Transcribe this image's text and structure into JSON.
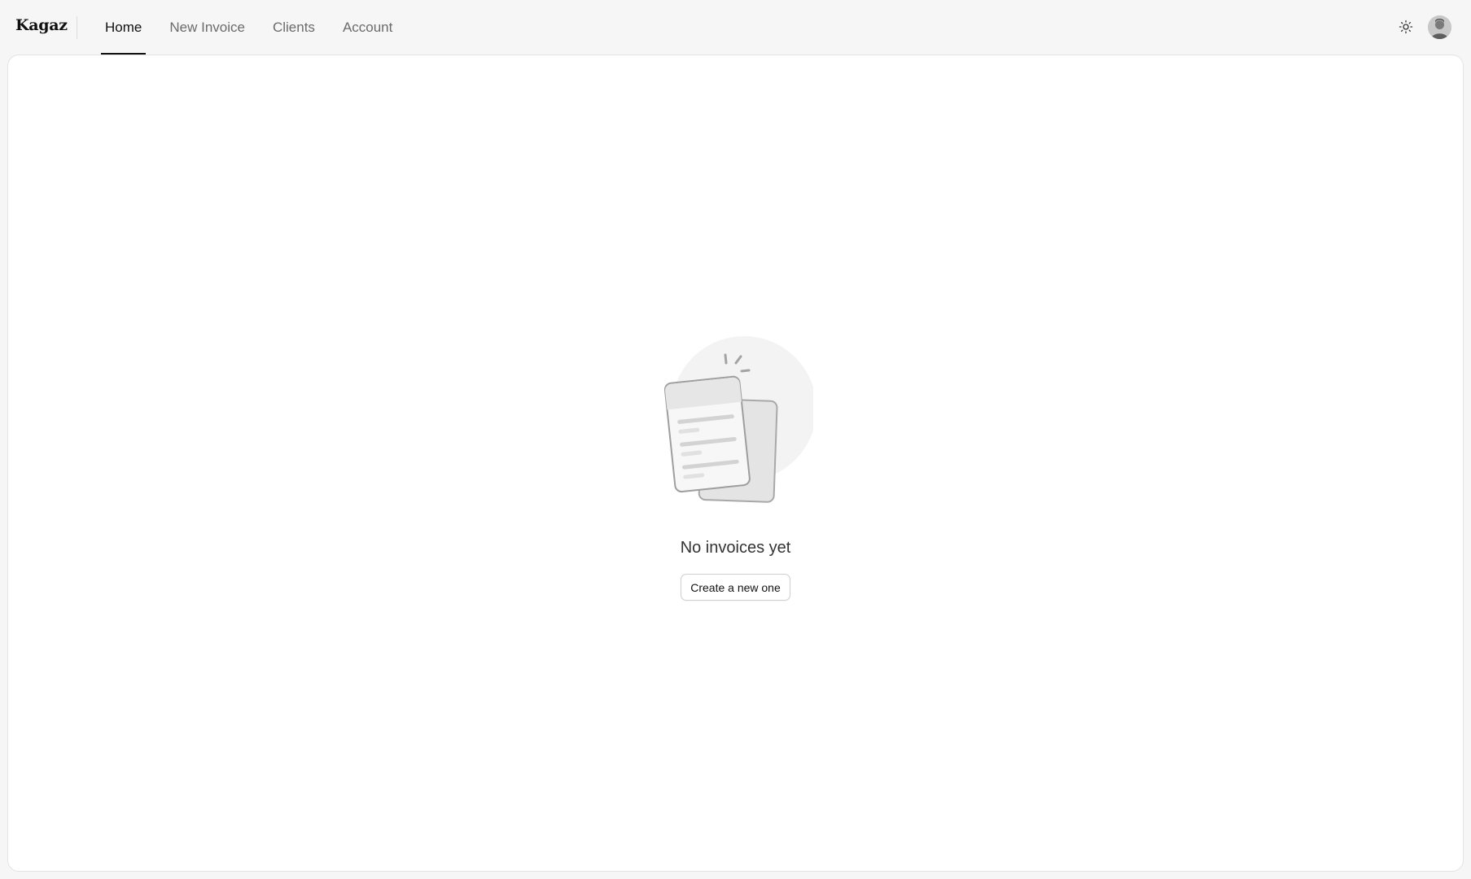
{
  "app": {
    "logo": "Kagaz"
  },
  "nav": {
    "items": [
      {
        "label": "Home",
        "active": true
      },
      {
        "label": "New Invoice",
        "active": false
      },
      {
        "label": "Clients",
        "active": false
      },
      {
        "label": "Account",
        "active": false
      }
    ]
  },
  "header": {
    "theme_icon": "sun-icon",
    "avatar_icon": "user-avatar"
  },
  "empty_state": {
    "illustration_icon": "documents-illustration",
    "title": "No invoices yet",
    "button_label": "Create a new one"
  },
  "colors": {
    "background": "#f6f6f6",
    "panel": "#ffffff",
    "active_underline": "#111111",
    "inactive_text": "#6b6b6b"
  }
}
